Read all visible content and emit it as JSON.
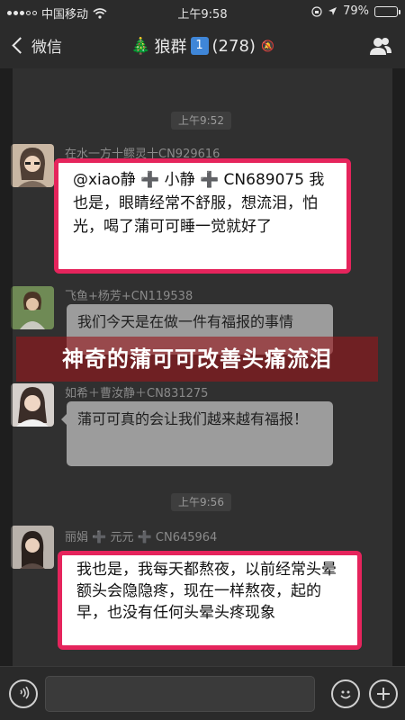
{
  "status_bar": {
    "carrier": "中国移动",
    "time": "上午9:58",
    "battery": "79%",
    "battery_level": 0.79
  },
  "nav": {
    "back_label": "微信",
    "group_name": "狼群",
    "badge": "1",
    "member_count": "(278)"
  },
  "chat": {
    "time_stamps": [
      "上午9:52",
      "上午9:56"
    ],
    "messages": [
      {
        "sender": "在水一方十鳏灵十CN929616",
        "text": "@xiao静 ➕ 小静 ➕ CN689075 我也是，眼睛经常不舒服，想流泪，怕光，喝了蒲可可睡一觉就好了"
      },
      {
        "sender": "飞鱼+杨芳+CN119538",
        "text": "我们今天是在做一件有福报的事情"
      },
      {
        "sender": "如希＋曹汝静＋CN831275",
        "text": "蒲可可真的会让我们越来越有福报！"
      },
      {
        "sender": "丽娟 ➕ 元元 ➕ CN645964",
        "text": "我也是，我每天都熬夜，以前经常头晕额头会隐隐疼，现在一样熬夜，起的早，也没有任何头晕头疼现象"
      }
    ]
  },
  "overlay_caption": "神奇的蒲可可改善头痛流泪",
  "input": {
    "voice_icon": "voice-icon",
    "emoji_icon": "emoji-icon",
    "plus_icon": "plus-icon"
  },
  "colors": {
    "highlight_border": "#e5245c",
    "caption_bg": "#96161c",
    "badge": "#3f86d8"
  }
}
